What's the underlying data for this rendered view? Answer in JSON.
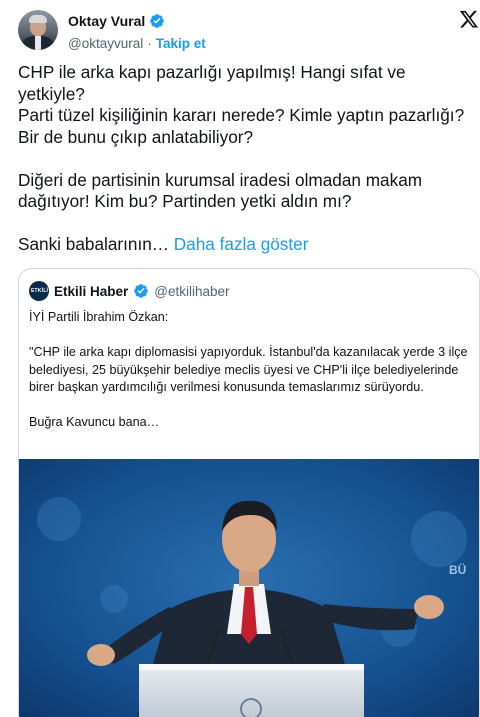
{
  "author": {
    "display_name": "Oktay Vural",
    "handle": "@oktayvural",
    "separator": "·",
    "follow_label": "Takip et"
  },
  "tweet": {
    "text": "CHP ile arka kapı pazarlığı yapılmış! Hangi sıfat ve\nyetkiyle?\nParti tüzel kişiliğinin kararı nerede? Kimle yaptın pazarlığı?\nBir de bunu çıkıp anlatabiliyor?\n\nDiğeri de partisinin kurumsal iradesi olmadan makam\ndağıtıyor!  Kim bu? Partinden yetki aldın mı?\n\nSanki babalarının… ",
    "show_more_label": "Daha fazla göster"
  },
  "quoted": {
    "display_name": "Etkili Haber",
    "handle": "@etkilihaber",
    "avatar_text": "ETKİLİ",
    "paragraphs": [
      "İYİ Partili İbrahim Özkan:",
      "\"CHP ile arka kapı diplomasisi yapıyorduk. İstanbul'da kazanılacak yerde 3 ilçe belediyesi, 25 büyükşehir belediye meclis üyesi ve CHP'li ilçe belediyelerinde birer başkan yardımcılığı verilmesi konusunda temaslarımız sürüyordu.",
      "Buğra Kavuncu bana…"
    ],
    "photo_backdrop_text": "BÜ"
  },
  "icons": {
    "verified": "verified-badge-icon",
    "platform": "x-logo-icon"
  },
  "colors": {
    "link_blue": "#1d9bf0",
    "text": "#0f1419",
    "secondary": "#536471",
    "border": "#cfd9de"
  }
}
